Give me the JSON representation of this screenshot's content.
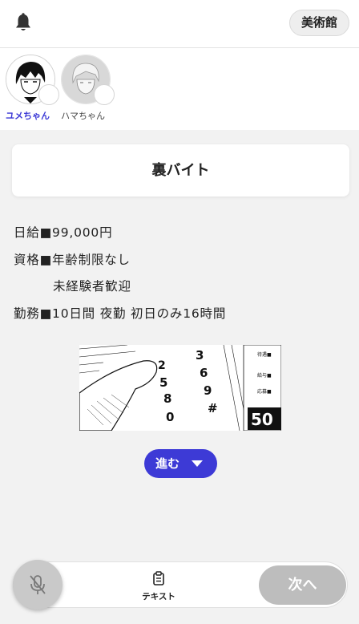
{
  "header": {
    "museum_label": "美術館"
  },
  "characters": [
    {
      "name": "ユメちゃん",
      "active": true
    },
    {
      "name": "ハマちゃん",
      "active": false
    }
  ],
  "story": {
    "title": "裏バイト",
    "lines": [
      "日給■99,000円",
      "資格■年齢制限なし",
      "未経験者歓迎",
      "勤務■10日間 夜勤 初日のみ16時間"
    ],
    "advance_label": "進む"
  },
  "bottom_bar": {
    "text_label": "テキスト",
    "next_label": "次へ"
  },
  "colors": {
    "accent": "#3d3ad6",
    "next_button": "#bdbdbd",
    "mic_button": "#c9c9c9"
  },
  "icons": [
    "bell-icon",
    "mic-off-icon",
    "clipboard-icon",
    "chevron-down-icon"
  ]
}
